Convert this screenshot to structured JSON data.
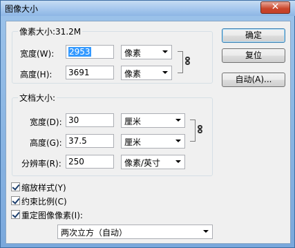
{
  "window": {
    "title": "图像大小",
    "close_label": "✕"
  },
  "pixel_dimensions": {
    "label": "像素大小:31.2M",
    "width": {
      "label": "宽度(W):",
      "value": "2953",
      "unit": "像素"
    },
    "height": {
      "label": "高度(H):",
      "value": "3691",
      "unit": "像素"
    }
  },
  "document_size": {
    "label": "文档大小:",
    "width": {
      "label": "宽度(D):",
      "value": "30",
      "unit": "厘米"
    },
    "height": {
      "label": "高度(G):",
      "value": "37.5",
      "unit": "厘米"
    },
    "resolution": {
      "label": "分辨率(R):",
      "value": "250",
      "unit": "像素/英寸"
    }
  },
  "buttons": {
    "ok": "确定",
    "reset": "复位",
    "auto": "自动(A)..."
  },
  "options": {
    "scale_styles": {
      "label": "缩放样式(Y)",
      "checked": true
    },
    "constrain": {
      "label": "约束比例(C)",
      "checked": true
    },
    "resample": {
      "label": "重定图像像素(I):",
      "checked": true
    },
    "resample_method": "两次立方（自动）"
  },
  "icons": {
    "link": "chain-link-icon",
    "check": "checkmark-icon",
    "dropdown": "chevron-down-icon"
  }
}
